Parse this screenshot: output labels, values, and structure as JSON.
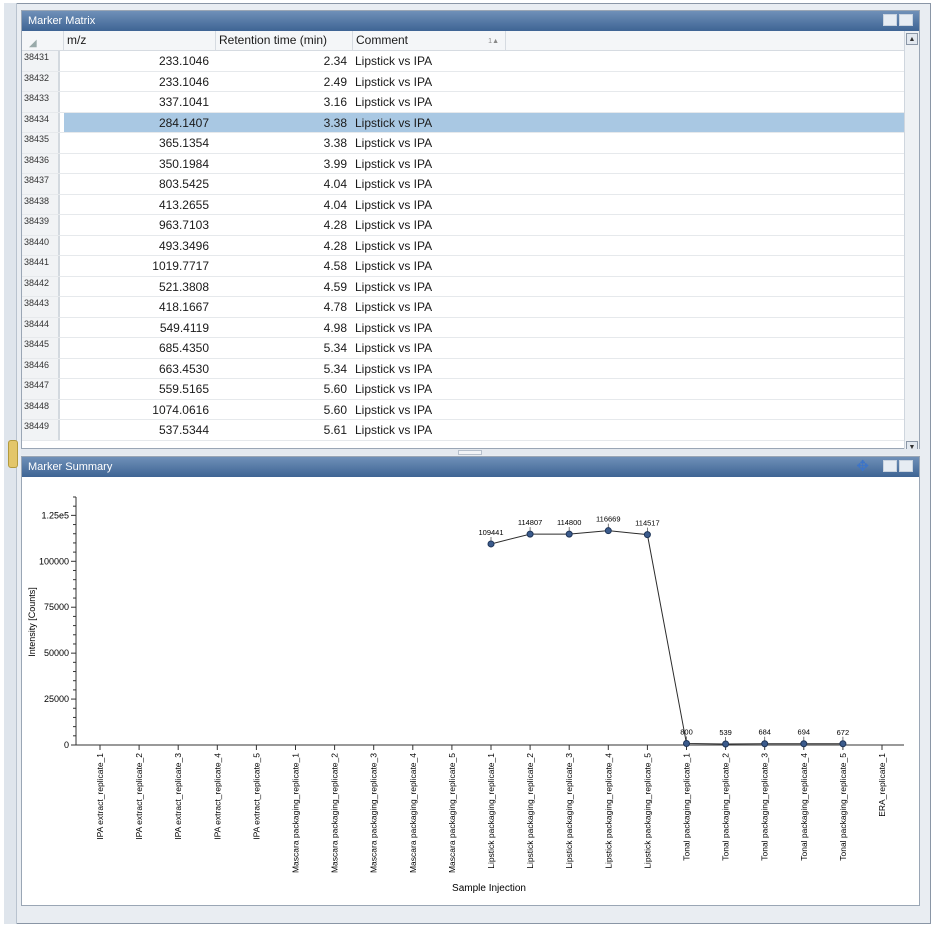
{
  "marker_matrix": {
    "title": "Marker Matrix",
    "columns": {
      "mz": "m/z",
      "rt": "Retention time (min)",
      "comment": "Comment"
    },
    "rows": [
      {
        "id": "38431",
        "mz": "233.1046",
        "rt": "2.34",
        "comment": "Lipstick vs IPA"
      },
      {
        "id": "38432",
        "mz": "233.1046",
        "rt": "2.49",
        "comment": "Lipstick vs IPA"
      },
      {
        "id": "38433",
        "mz": "337.1041",
        "rt": "3.16",
        "comment": "Lipstick vs IPA"
      },
      {
        "id": "38434",
        "mz": "284.1407",
        "rt": "3.38",
        "comment": "Lipstick vs IPA",
        "selected": true
      },
      {
        "id": "38435",
        "mz": "365.1354",
        "rt": "3.38",
        "comment": "Lipstick vs IPA"
      },
      {
        "id": "38436",
        "mz": "350.1984",
        "rt": "3.99",
        "comment": "Lipstick vs IPA"
      },
      {
        "id": "38437",
        "mz": "803.5425",
        "rt": "4.04",
        "comment": "Lipstick vs IPA"
      },
      {
        "id": "38438",
        "mz": "413.2655",
        "rt": "4.04",
        "comment": "Lipstick vs IPA"
      },
      {
        "id": "38439",
        "mz": "963.7103",
        "rt": "4.28",
        "comment": "Lipstick vs IPA"
      },
      {
        "id": "38440",
        "mz": "493.3496",
        "rt": "4.28",
        "comment": "Lipstick vs IPA"
      },
      {
        "id": "38441",
        "mz": "1019.7717",
        "rt": "4.58",
        "comment": "Lipstick vs IPA"
      },
      {
        "id": "38442",
        "mz": "521.3808",
        "rt": "4.59",
        "comment": "Lipstick vs IPA"
      },
      {
        "id": "38443",
        "mz": "418.1667",
        "rt": "4.78",
        "comment": "Lipstick vs IPA"
      },
      {
        "id": "38444",
        "mz": "549.4119",
        "rt": "4.98",
        "comment": "Lipstick vs IPA"
      },
      {
        "id": "38445",
        "mz": "685.4350",
        "rt": "5.34",
        "comment": "Lipstick vs IPA"
      },
      {
        "id": "38446",
        "mz": "663.4530",
        "rt": "5.34",
        "comment": "Lipstick vs IPA"
      },
      {
        "id": "38447",
        "mz": "559.5165",
        "rt": "5.60",
        "comment": "Lipstick vs IPA"
      },
      {
        "id": "38448",
        "mz": "1074.0616",
        "rt": "5.60",
        "comment": "Lipstick vs IPA"
      },
      {
        "id": "38449",
        "mz": "537.5344",
        "rt": "5.61",
        "comment": "Lipstick vs IPA"
      }
    ]
  },
  "marker_summary": {
    "title": "Marker Summary"
  },
  "colors": {
    "titlebar": "#4a6fa0",
    "selection": "#a9c8e3",
    "series": "#2f4f7f"
  },
  "chart_data": {
    "type": "line",
    "xlabel": "Sample Injection",
    "ylabel": "Intensity [Counts]",
    "ylim": [
      0,
      135000
    ],
    "yticks": [
      {
        "v": 0,
        "label": "0"
      },
      {
        "v": 25000,
        "label": "25000"
      },
      {
        "v": 50000,
        "label": "50000"
      },
      {
        "v": 75000,
        "label": "75000"
      },
      {
        "v": 100000,
        "label": "100000"
      },
      {
        "v": 125000,
        "label": "1.25e5"
      }
    ],
    "categories": [
      "IPA extract_replicate_1",
      "IPA extract_replicate_2",
      "IPA extract_replicate_3",
      "IPA extract_replicate_4",
      "IPA extract_replicate_5",
      "Mascara packaging_replicate_1",
      "Mascara packaging_replicate_2",
      "Mascara packaging_replicate_3",
      "Mascara packaging_replicate_4",
      "Mascara packaging_replicate_5",
      "Lipstick packaging_replicate_1",
      "Lipstick packaging_replicate_2",
      "Lipstick packaging_replicate_3",
      "Lipstick packaging_replicate_4",
      "Lipstick packaging_replicate_5",
      "Tonal packaging_replicate_1",
      "Tonal packaging_replicate_2",
      "Tonal packaging_replicate_3",
      "Tonal packaging_replicate_4",
      "Tonal packaging_replicate_5",
      "ERA_replicate_1"
    ],
    "values": [
      null,
      null,
      null,
      null,
      null,
      null,
      null,
      null,
      null,
      null,
      109441,
      114807,
      114800,
      116669,
      114517,
      800,
      539,
      684,
      694,
      672,
      null
    ],
    "data_labels": [
      null,
      null,
      null,
      null,
      null,
      null,
      null,
      null,
      null,
      null,
      "109441",
      "114807",
      "114800",
      "116669",
      "114517",
      "800",
      "539",
      "684",
      "694",
      "672",
      null
    ]
  }
}
